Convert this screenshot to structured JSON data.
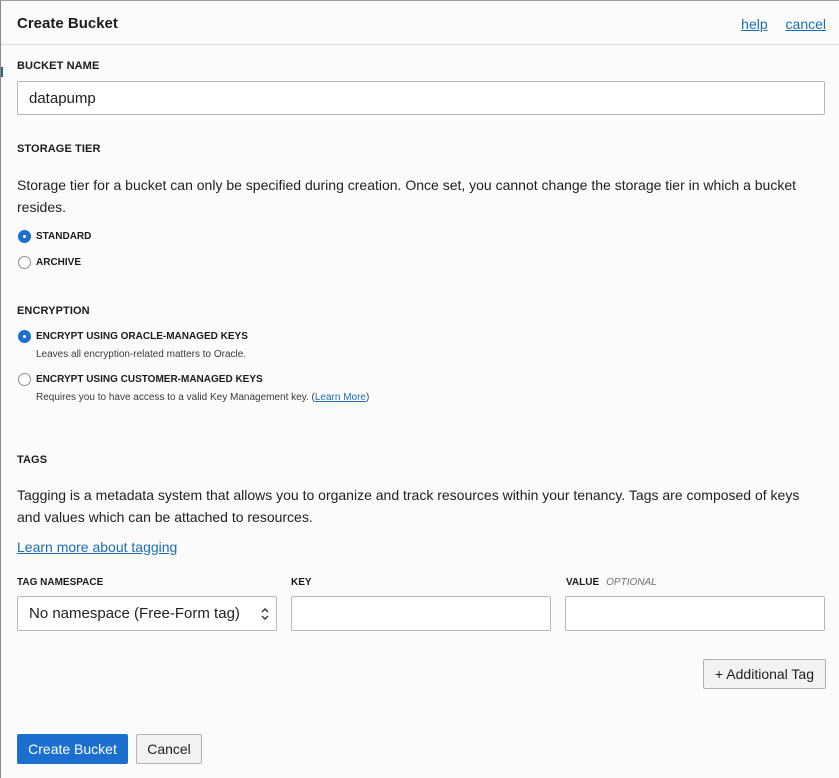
{
  "header": {
    "title": "Create Bucket",
    "help": "help",
    "cancel": "cancel"
  },
  "bucket_name": {
    "label": "BUCKET NAME",
    "value": "datapump"
  },
  "storage_tier": {
    "label": "STORAGE TIER",
    "description": "Storage tier for a bucket can only be specified during creation. Once set, you cannot change the storage tier in which a bucket resides.",
    "options": [
      {
        "label": "STANDARD",
        "selected": true
      },
      {
        "label": "ARCHIVE",
        "selected": false
      }
    ]
  },
  "encryption": {
    "label": "ENCRYPTION",
    "options": [
      {
        "label": "ENCRYPT USING ORACLE-MANAGED KEYS",
        "description": "Leaves all encryption-related matters to Oracle.",
        "selected": true
      },
      {
        "label": "ENCRYPT USING CUSTOMER-MANAGED KEYS",
        "description": "Requires you to have access to a valid Key Management key. (",
        "link": "Learn More",
        "description_end": ")",
        "selected": false
      }
    ]
  },
  "tags": {
    "label": "TAGS",
    "description": "Tagging is a metadata system that allows you to organize and track resources within your tenancy. Tags are composed of keys and values which can be attached to resources.",
    "learn_link": "Learn more about tagging",
    "columns": {
      "namespace": "TAG NAMESPACE",
      "key": "KEY",
      "value": "VALUE",
      "optional": "OPTIONAL"
    },
    "namespace_selected": "No namespace (Free-Form tag)",
    "key_value": "",
    "value_value": "",
    "additional_tag": "+ Additional Tag"
  },
  "footer": {
    "create": "Create Bucket",
    "cancel": "Cancel"
  },
  "colors": {
    "accent": "#1a6fcf",
    "link": "#1a6fb4"
  }
}
